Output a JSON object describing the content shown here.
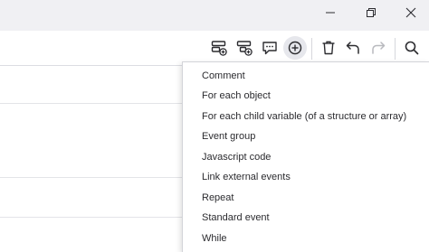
{
  "window_controls": {
    "minimize": "minimize-icon",
    "restore": "restore-icon",
    "close": "close-icon"
  },
  "toolbar": {
    "buttons": [
      {
        "name": "add-event-icon"
      },
      {
        "name": "add-sub-event-icon"
      },
      {
        "name": "add-comment-icon"
      },
      {
        "name": "add-other-icon"
      },
      {
        "name": "delete-icon"
      },
      {
        "name": "undo-icon"
      },
      {
        "name": "redo-icon"
      },
      {
        "name": "search-icon"
      }
    ]
  },
  "menu": {
    "items": [
      {
        "label": "Comment"
      },
      {
        "label": "For each object"
      },
      {
        "label": "For each child variable (of a structure or array)"
      },
      {
        "label": "Event group"
      },
      {
        "label": "Javascript code"
      },
      {
        "label": "Link external events"
      },
      {
        "label": "Repeat"
      },
      {
        "label": "Standard event"
      },
      {
        "label": "While"
      }
    ]
  },
  "colors": {
    "titlebar_bg": "#f0f0f3",
    "text": "#2b2b2f",
    "icon": "#2b2b2f",
    "disabled_icon": "#b8b9be"
  }
}
